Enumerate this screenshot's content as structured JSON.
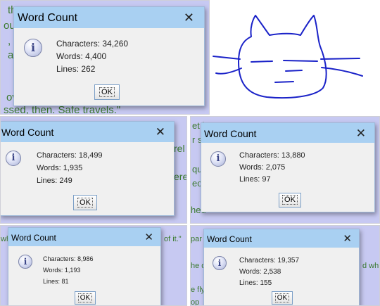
{
  "panels": [
    {
      "dialog_title": "Word Count",
      "close_glyph": "✕",
      "ok_label": "OK",
      "characters": "Characters: 34,260",
      "words": "Words: 4,400",
      "lines": "Lines: 262",
      "bg_text": [
        "th",
        "ou",
        ",",
        "a",
        "ov",
        "ssed, then. Safe travels.\""
      ]
    },
    {
      "dialog_title": "Word Count",
      "close_glyph": "✕",
      "ok_label": "OK",
      "characters": "Characters: 18,499",
      "words": "Words: 1,935",
      "lines": "Lines: 249",
      "bg_text": [
        "rel",
        "ere"
      ]
    },
    {
      "dialog_title": "Word Count",
      "close_glyph": "✕",
      "ok_label": "OK",
      "characters": "Characters: 13,880",
      "words": "Words: 2,075",
      "lines": "Lines: 97",
      "bg_text": [
        "et i",
        "r s",
        "qui",
        "ect",
        "hed"
      ]
    },
    {
      "dialog_title": "Word Count",
      "close_glyph": "✕",
      "ok_label": "OK",
      "characters": "Characters: 8,986",
      "words": "Words: 1,193",
      "lines": "Lines: 81",
      "bg_text": [
        "wh",
        "of it.\""
      ]
    },
    {
      "dialog_title": "Word Count",
      "close_glyph": "✕",
      "ok_label": "OK",
      "characters": "Characters: 19,357",
      "words": "Words: 2,538",
      "lines": "Lines: 155",
      "bg_text": [
        "par",
        "he d",
        "d wh",
        "e fly",
        "op"
      ]
    }
  ],
  "sketch": {
    "subject": "cat-face-doodle",
    "ink_color": "#1a22c8"
  }
}
